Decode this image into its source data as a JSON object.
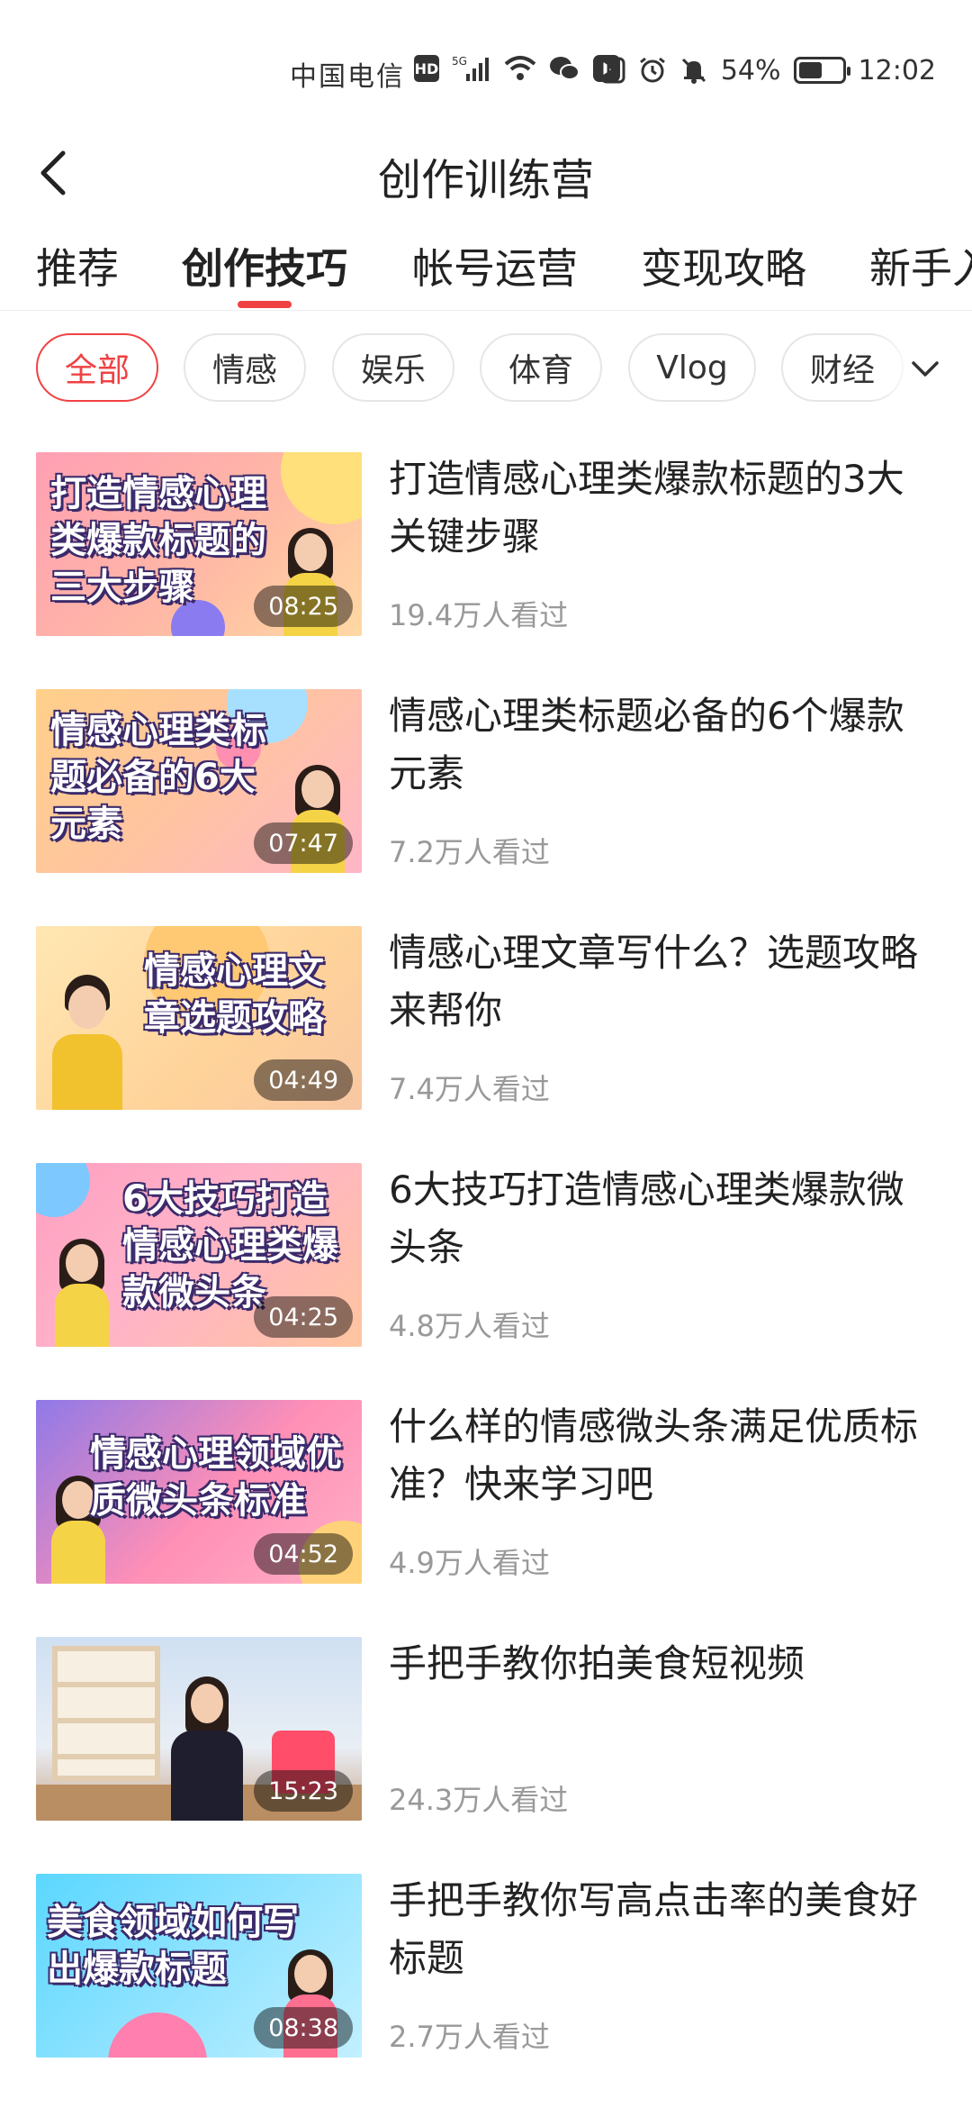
{
  "status_bar": {
    "carrier": "中国电信",
    "hd": "HD",
    "network": "5G",
    "battery_percent": "54%",
    "battery_level": 0.54,
    "time": "12:02"
  },
  "header": {
    "title": "创作训练营"
  },
  "tabs": [
    {
      "label": "推荐"
    },
    {
      "label": "创作技巧"
    },
    {
      "label": "帐号运营"
    },
    {
      "label": "变现攻略"
    },
    {
      "label": "新手入"
    }
  ],
  "active_tab": "创作技巧",
  "chips": [
    {
      "label": "全部"
    },
    {
      "label": "情感"
    },
    {
      "label": "娱乐"
    },
    {
      "label": "体育"
    },
    {
      "label": "Vlog"
    },
    {
      "label": "财经"
    }
  ],
  "active_chip": "全部",
  "accent_color": "#f04142",
  "videos": [
    {
      "title": "打造情感心理类爆款标题的3大关键步骤",
      "views": "19.4万人看过",
      "duration": "08:25",
      "thumb_text": "打造情感心理类爆款标题的三大步骤"
    },
    {
      "title": "情感心理类标题必备的6个爆款元素",
      "views": "7.2万人看过",
      "duration": "07:47",
      "thumb_text": "情感心理类标题必备的6大元素"
    },
    {
      "title": "情感心理文章写什么？选题攻略来帮你",
      "views": "7.4万人看过",
      "duration": "04:49",
      "thumb_text": "情感心理文章选题攻略"
    },
    {
      "title": "6大技巧打造情感心理类爆款微头条",
      "views": "4.8万人看过",
      "duration": "04:25",
      "thumb_text": "6大技巧打造情感心理类爆款微头条"
    },
    {
      "title": "什么样的情感微头条满足优质标准？快来学习吧",
      "views": "4.9万人看过",
      "duration": "04:52",
      "thumb_text": "情感心理领域优质微头条标准"
    },
    {
      "title": "手把手教你拍美食短视频",
      "views": "24.3万人看过",
      "duration": "15:23",
      "thumb_text": ""
    },
    {
      "title": "手把手教你写高点击率的美食好标题",
      "views": "2.7万人看过",
      "duration": "08:38",
      "thumb_text": "美食领域如何写出爆款标题"
    }
  ]
}
